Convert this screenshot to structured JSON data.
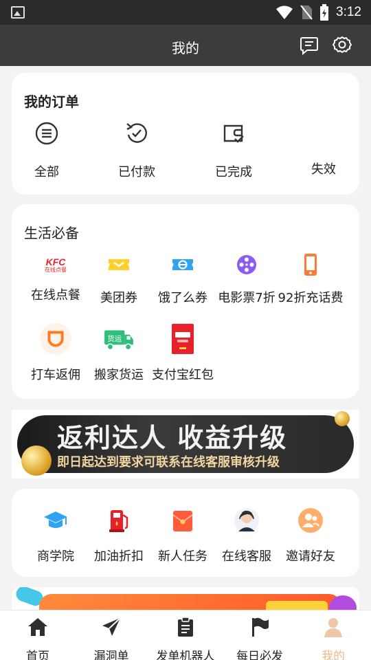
{
  "status_bar": {
    "time": "3:12"
  },
  "header": {
    "title": "我的"
  },
  "orders": {
    "title": "我的订单",
    "items": [
      {
        "label": "全部",
        "icon": "list-circle-icon"
      },
      {
        "label": "已付款",
        "icon": "refresh-check-icon"
      },
      {
        "label": "已完成",
        "icon": "wallet-check-icon"
      },
      {
        "label": "失效",
        "icon": ""
      }
    ]
  },
  "life": {
    "title": "生活必备",
    "items": [
      {
        "label": "在线点餐",
        "icon": "kfc-logo-icon",
        "logo_text": "KFC",
        "logo_sub": "在线点餐"
      },
      {
        "label": "美团券",
        "icon": "meituan-ticket-icon"
      },
      {
        "label": "饿了么券",
        "icon": "eleme-ticket-icon"
      },
      {
        "label": "电影票7折",
        "icon": "film-reel-icon"
      },
      {
        "label": "92折充话费",
        "icon": "phone-icon"
      },
      {
        "label": "打车返佣",
        "icon": "didi-icon"
      },
      {
        "label": "搬家货运",
        "icon": "truck-icon",
        "logo_text": "货运"
      },
      {
        "label": "支付宝红包",
        "icon": "red-packet-icon"
      }
    ]
  },
  "banner": {
    "headline": "返利达人 收益升级",
    "subline": "即日起达到要求可联系在线客服审核升级"
  },
  "tools": {
    "items": [
      {
        "label": "商学院",
        "icon": "graduation-cap-icon"
      },
      {
        "label": "加油折扣",
        "icon": "fuel-pump-icon"
      },
      {
        "label": "新人任务",
        "icon": "red-envelope-icon"
      },
      {
        "label": "在线客服",
        "icon": "support-agent-avatar"
      },
      {
        "label": "邀请好友",
        "icon": "invite-friends-icon"
      }
    ]
  },
  "tab_bar": {
    "items": [
      {
        "label": "首页",
        "icon": "home-icon"
      },
      {
        "label": "漏洞单",
        "icon": "send-icon"
      },
      {
        "label": "发单机器人",
        "icon": "clipboard-icon"
      },
      {
        "label": "每日必发",
        "icon": "flag-icon"
      },
      {
        "label": "我的",
        "icon": "user-icon",
        "active": true
      }
    ]
  },
  "colors": {
    "accent": "#f0b98a",
    "header_bg": "#3c3c3c",
    "status_bg": "#2b2b2b"
  }
}
